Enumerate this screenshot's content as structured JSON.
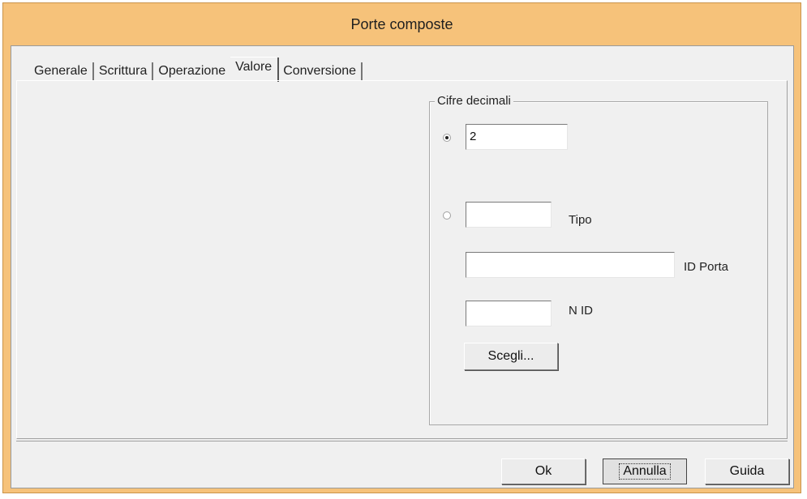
{
  "window": {
    "title": "Porte composte"
  },
  "tabs": [
    {
      "label": "Generale",
      "active": false
    },
    {
      "label": "Scrittura",
      "active": false
    },
    {
      "label": "Operazione",
      "active": false
    },
    {
      "label": "Valore",
      "active": true
    },
    {
      "label": "Conversione",
      "active": false
    }
  ],
  "decimals_group": {
    "label": "Cifre decimali",
    "fixed_option": {
      "selected": true,
      "value": "2"
    },
    "port_option": {
      "selected": false,
      "tipo_value": "",
      "tipo_label": "Tipo",
      "id_porta_value": "",
      "id_porta_label": "ID Porta",
      "n_id_value": "",
      "n_id_label": "N ID",
      "choose_label": "Scegli..."
    }
  },
  "buttons": {
    "ok": "Ok",
    "cancel": "Annulla",
    "help": "Guida"
  },
  "colors": {
    "title_bar": "#f6c27a",
    "client_bg": "#f0f0f0"
  }
}
